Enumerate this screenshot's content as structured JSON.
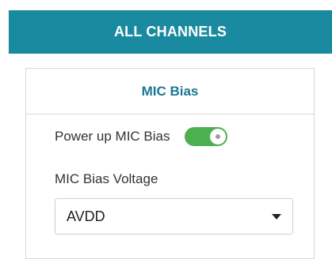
{
  "header": {
    "title": "ALL CHANNELS",
    "background_color": "#1a8aa0"
  },
  "panel": {
    "title": "MIC Bias",
    "title_color": "#1a7a92"
  },
  "power_toggle": {
    "label": "Power up MIC Bias",
    "state": "on",
    "color": "#4caf50"
  },
  "voltage": {
    "label": "MIC Bias Voltage",
    "selected": "AVDD"
  }
}
